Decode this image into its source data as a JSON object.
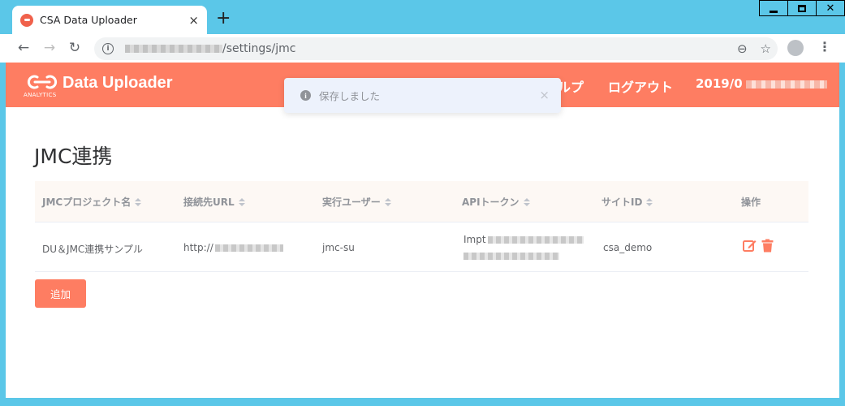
{
  "browser": {
    "tab_title": "CSA Data Uploader",
    "tab_close": "×",
    "new_tab": "+",
    "url_path": "/settings/jmc",
    "colors": {
      "frame": "#5bc7e8",
      "omnibox": "#f1f3f4"
    }
  },
  "header": {
    "logo_sub": "ANALYTICS",
    "brand": "Data Uploader",
    "nav_help": "ルプ",
    "nav_logout": "ログアウト",
    "nav_date": "2019/0",
    "accent_color": "#fe7d62"
  },
  "toast": {
    "icon": "i",
    "message": "保存しました",
    "close": "×"
  },
  "page": {
    "title": "JMC連携"
  },
  "table": {
    "headers": [
      {
        "label": "JMCプロジェクト名",
        "sortable": true
      },
      {
        "label": "接続先URL",
        "sortable": true
      },
      {
        "label": "実行ユーザー",
        "sortable": true
      },
      {
        "label": "APIトークン",
        "sortable": true
      },
      {
        "label": "サイトID",
        "sortable": true
      },
      {
        "label": "操作",
        "sortable": false
      }
    ],
    "rows": [
      {
        "project": "DU＆JMC連携サンプル",
        "url": "http://",
        "user": "jmc-su",
        "token": "Impt",
        "site_id": "csa_demo",
        "actions": [
          "edit-icon",
          "trash-icon"
        ]
      }
    ]
  },
  "buttons": {
    "add": "追加"
  }
}
